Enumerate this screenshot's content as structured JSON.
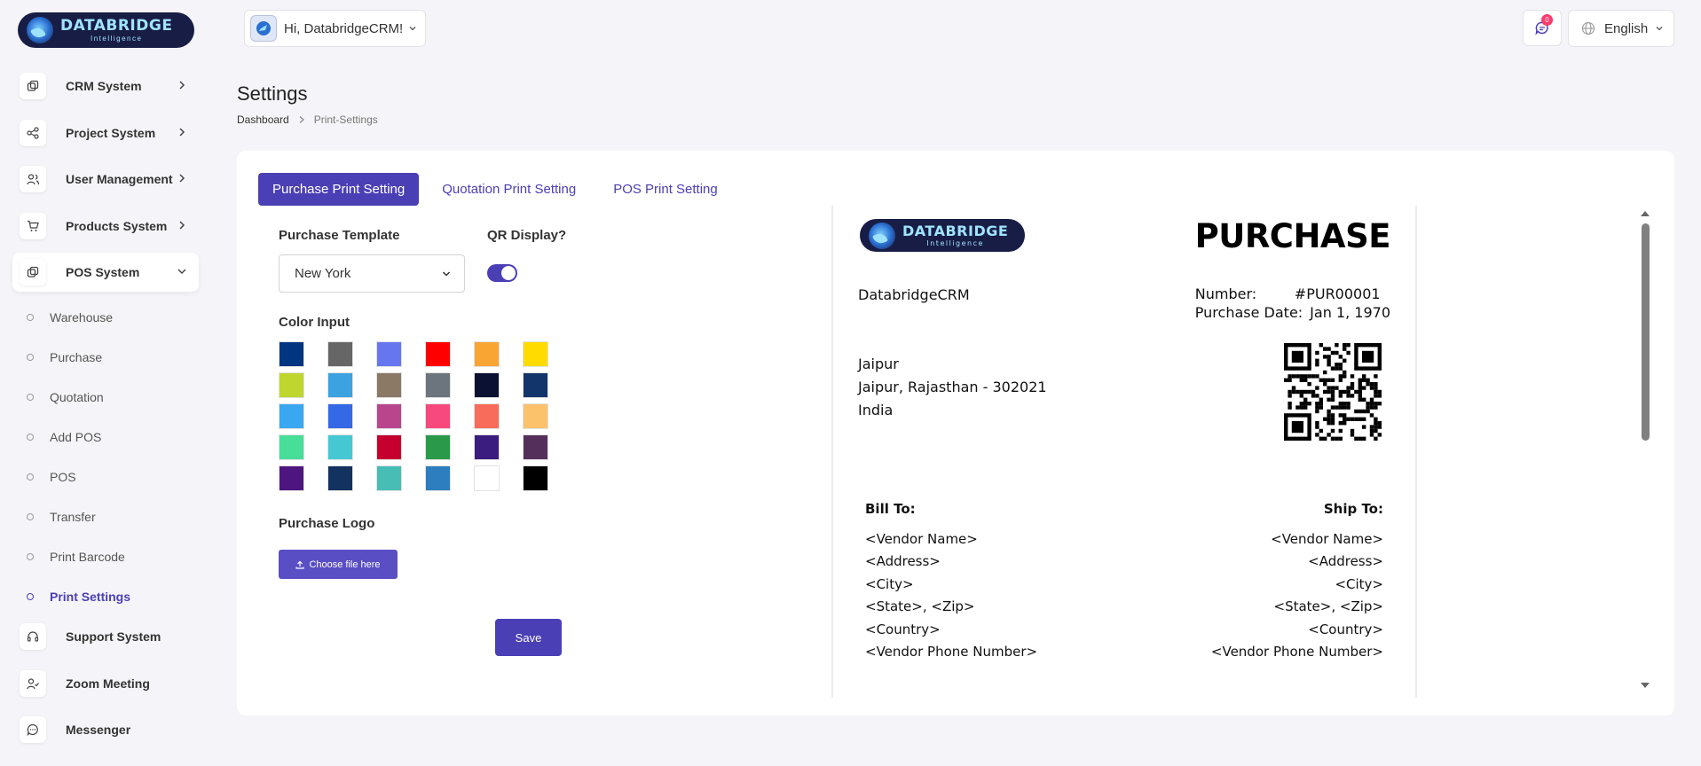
{
  "brand": {
    "word": "DATABRIDGE",
    "sub": "Intelligence"
  },
  "topbar": {
    "greeting": "Hi, DatabridgeCRM!",
    "notifications_count": "0",
    "language": "English"
  },
  "sidebar": {
    "items": [
      {
        "label": "CRM System",
        "icon": "crm-icon"
      },
      {
        "label": "Project System",
        "icon": "project-icon"
      },
      {
        "label": "User Management",
        "icon": "users-icon"
      },
      {
        "label": "Products System",
        "icon": "cart-icon"
      },
      {
        "label": "POS System",
        "icon": "pos-icon"
      }
    ],
    "sub_items": [
      {
        "label": "Warehouse"
      },
      {
        "label": "Purchase"
      },
      {
        "label": "Quotation"
      },
      {
        "label": "Add POS"
      },
      {
        "label": "POS"
      },
      {
        "label": "Transfer"
      },
      {
        "label": "Print Barcode"
      },
      {
        "label": "Print Settings"
      }
    ],
    "items_after": [
      {
        "label": "Support System",
        "icon": "headset-icon"
      },
      {
        "label": "Zoom Meeting",
        "icon": "meeting-icon"
      },
      {
        "label": "Messenger",
        "icon": "chat-icon"
      }
    ]
  },
  "page": {
    "title": "Settings",
    "breadcrumb": {
      "home": "Dashboard",
      "current": "Print-Settings"
    }
  },
  "tabs": [
    {
      "label": "Purchase Print Setting"
    },
    {
      "label": "Quotation Print Setting"
    },
    {
      "label": "POS Print Setting"
    }
  ],
  "form": {
    "template_label": "Purchase Template",
    "template_value": "New York",
    "qr_label": "QR Display?",
    "qr_enabled": true,
    "color_label": "Color Input",
    "colors": [
      "#003580",
      "#666666",
      "#6676ef",
      "#ff0000",
      "#f9a533",
      "#ffdb00",
      "#bfd62f",
      "#3ca2e0",
      "#8b7865",
      "#6c757d",
      "#0a1133",
      "#12356b",
      "#3aa7f1",
      "#3568e4",
      "#b9458d",
      "#f7497d",
      "#f76c5a",
      "#fbc26b",
      "#47de98",
      "#45c8d2",
      "#c5002e",
      "#2a9a4a",
      "#3b1c7f",
      "#552f5c",
      "#4e1581",
      "#13325f",
      "#47bdb5",
      "#2c7ebf",
      "#ffffff",
      "#000000"
    ],
    "logo_label": "Purchase Logo",
    "upload_label": "Choose file here",
    "save_label": "Save"
  },
  "preview": {
    "title": "PURCHASE",
    "company": "DatabridgeCRM",
    "number_label": "Number:",
    "number_value": "#PUR00001",
    "date_label": "Purchase Date:",
    "date_value": "Jan 1, 1970",
    "address_lines": [
      "Jaipur",
      "Jaipur, Rajasthan - 302021",
      "India"
    ],
    "bill_to": {
      "heading": "Bill To:",
      "lines": [
        "<Vendor Name>",
        "<Address>",
        "<City>",
        "<State>, <Zip>",
        "<Country>",
        "<Vendor Phone Number>"
      ]
    },
    "ship_to": {
      "heading": "Ship To:",
      "lines": [
        "<Vendor Name>",
        "<Address>",
        "<City>",
        "<State>, <Zip>",
        "<Country>",
        "<Vendor Phone Number>"
      ]
    }
  }
}
